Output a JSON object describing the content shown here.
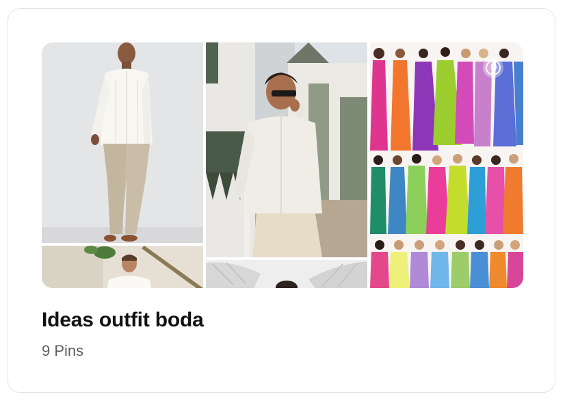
{
  "board": {
    "title": "Ideas outfit boda",
    "pin_count": "9 Pins"
  },
  "icons": {
    "pinterest_badge": "pinterest-logo-icon"
  },
  "colors": {
    "title_text": "#111111",
    "secondary_text": "#5f5f5f",
    "card_border": "#e4e4e4"
  }
}
